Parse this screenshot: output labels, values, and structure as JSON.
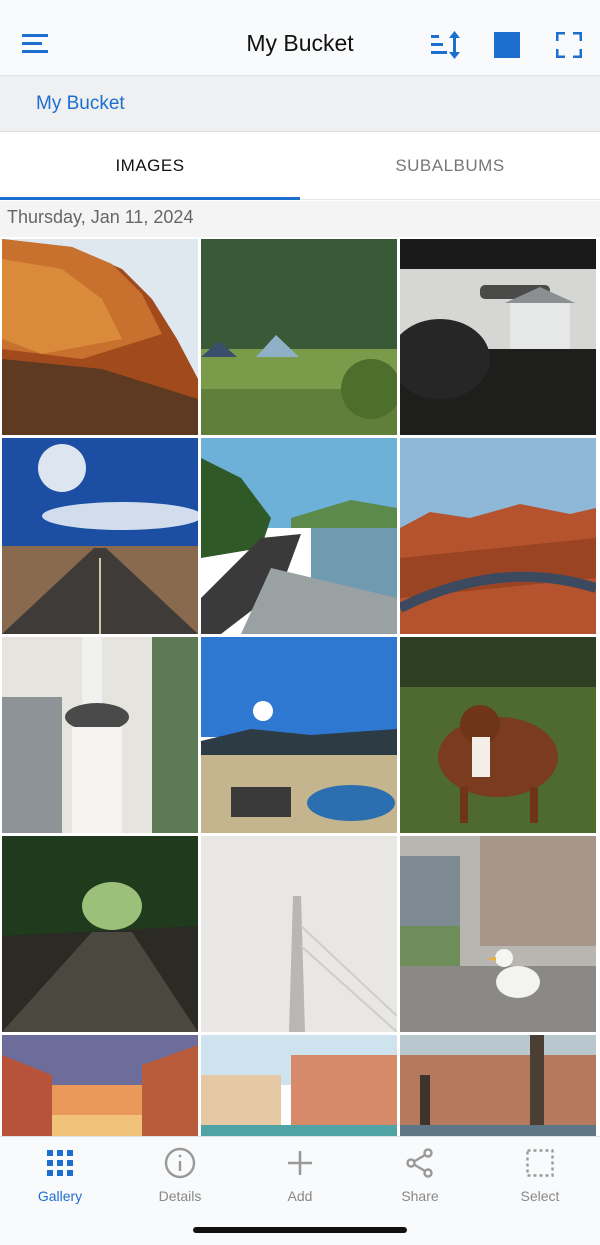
{
  "header": {
    "title": "My Bucket",
    "icons": [
      "menu-icon",
      "sort-icon",
      "square-icon",
      "fullscreen-icon"
    ],
    "accent_color": "#1d6fcf"
  },
  "breadcrumb": {
    "label": "My Bucket"
  },
  "tabs": [
    {
      "label": "IMAGES",
      "selected": true
    },
    {
      "label": "SUBALBUMS",
      "selected": false
    }
  ],
  "gallery": {
    "date_header": "Thursday, Jan 11, 2024",
    "photos": [
      "sandstone-cliff",
      "camping-tents",
      "car-interior-mirror",
      "desert-road-sun",
      "coastal-road",
      "mountain-highway",
      "woman-in-hat",
      "sunny-pool-terrace",
      "brown-dog-field",
      "forest-path",
      "foggy-tower",
      "seagull-street",
      "venice-sunset",
      "venice-canal",
      "venice-harbor"
    ]
  },
  "bottom_nav": [
    {
      "label": "Gallery",
      "icon": "grid-icon",
      "active": true
    },
    {
      "label": "Details",
      "icon": "info-icon",
      "active": false
    },
    {
      "label": "Add",
      "icon": "plus-icon",
      "active": false
    },
    {
      "label": "Share",
      "icon": "share-icon",
      "active": false
    },
    {
      "label": "Select",
      "icon": "select-icon",
      "active": false
    }
  ]
}
